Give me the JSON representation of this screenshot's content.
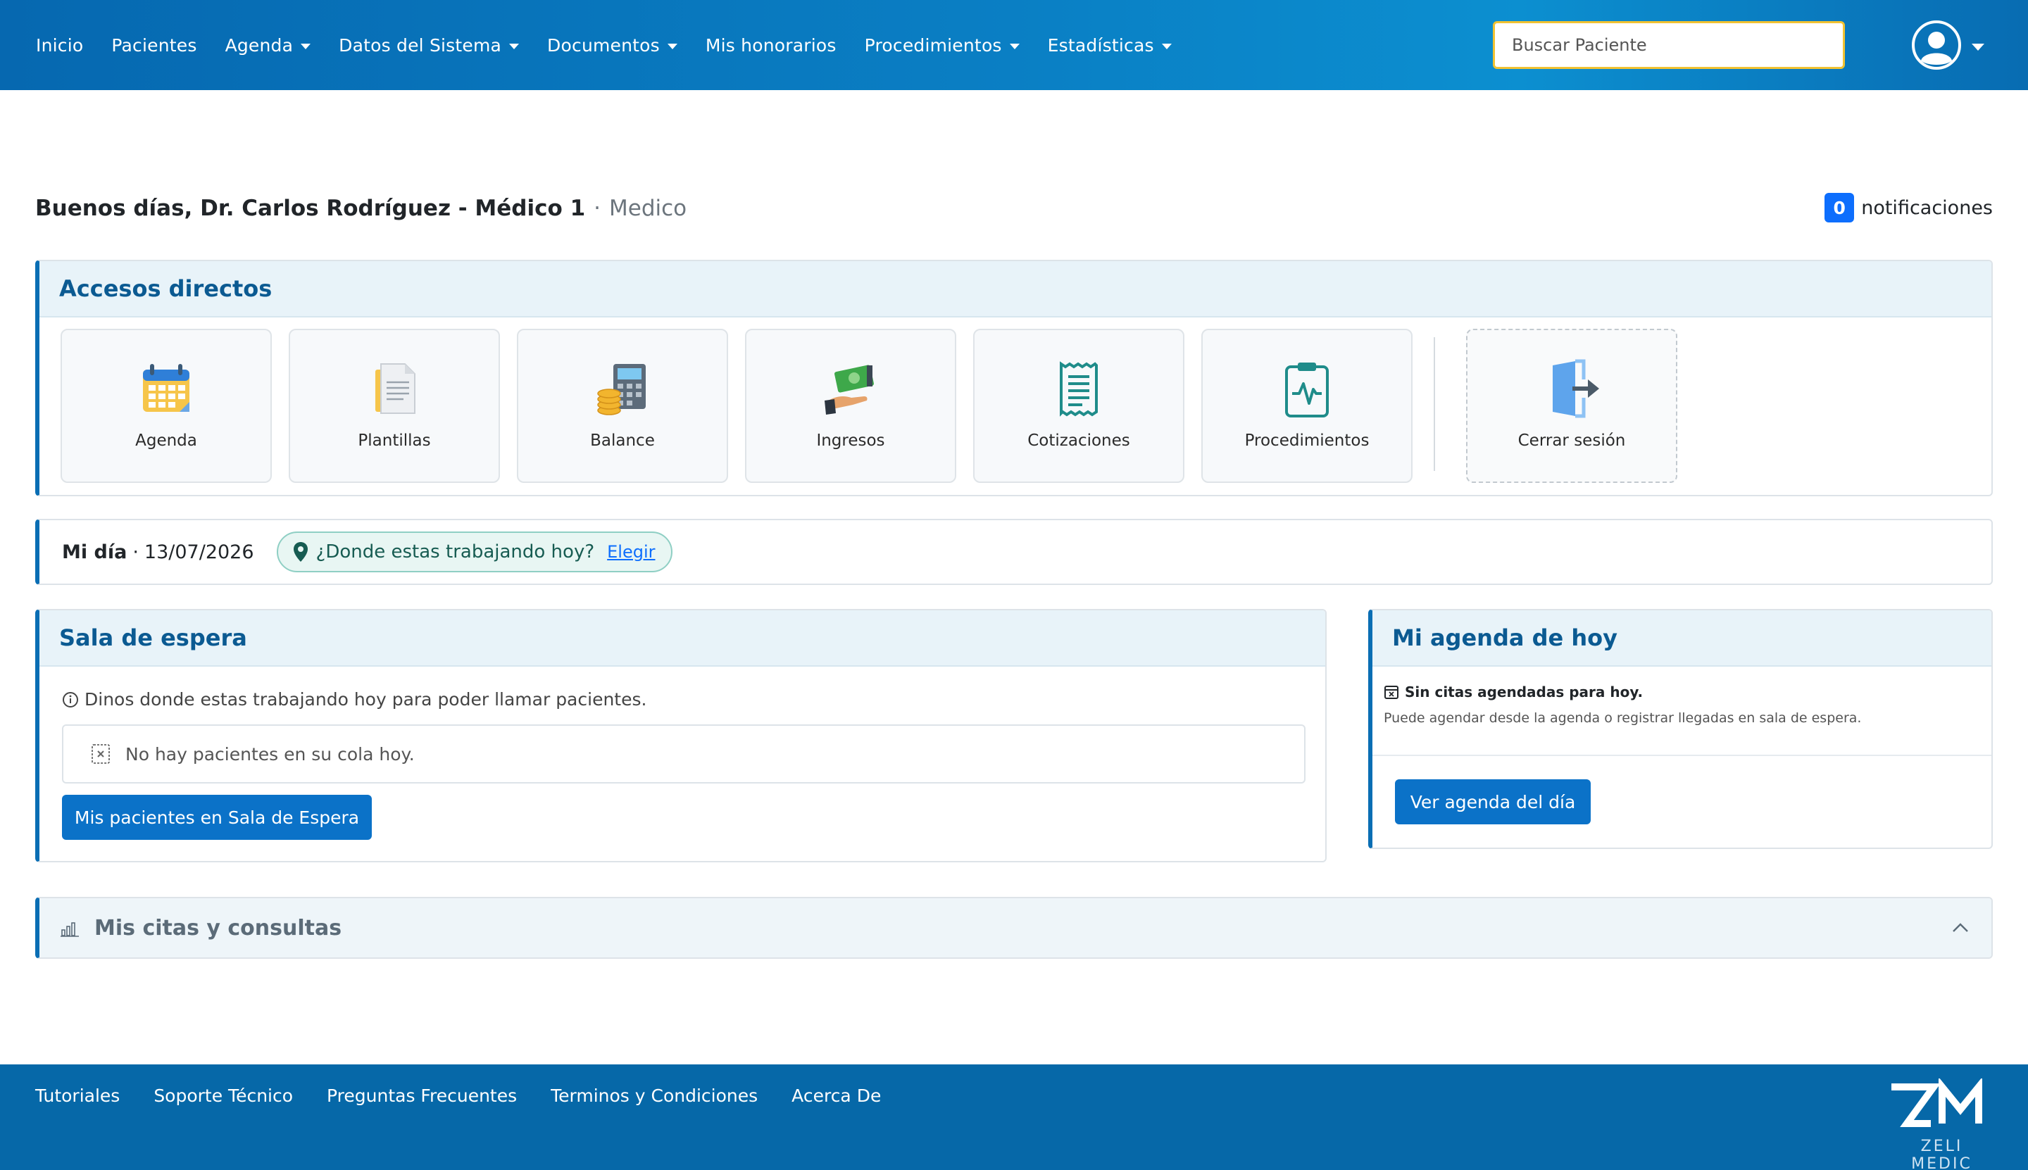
{
  "nav": {
    "items": [
      {
        "label": "Inicio",
        "dropdown": false
      },
      {
        "label": "Pacientes",
        "dropdown": false
      },
      {
        "label": "Agenda",
        "dropdown": true
      },
      {
        "label": "Datos del Sistema",
        "dropdown": true
      },
      {
        "label": "Documentos",
        "dropdown": true
      },
      {
        "label": "Mis honorarios",
        "dropdown": false
      },
      {
        "label": "Procedimientos",
        "dropdown": true
      },
      {
        "label": "Estadísticas",
        "dropdown": true
      }
    ],
    "search_placeholder": "Buscar Paciente",
    "colors": {
      "bar": "#0a7fc4",
      "search_border": "#f1c232"
    }
  },
  "greeting": {
    "text": "Buenos días, Dr. Carlos Rodríguez - Médico 1",
    "separator": "·",
    "role": "Medico"
  },
  "notifications": {
    "count": "0",
    "label": "notificaciones"
  },
  "accesos": {
    "title": "Accesos directos",
    "tiles": [
      {
        "label": "Agenda",
        "icon": "calendar-icon"
      },
      {
        "label": "Plantillas",
        "icon": "document-icon"
      },
      {
        "label": "Balance",
        "icon": "calculator-coins-icon"
      },
      {
        "label": "Ingresos",
        "icon": "money-hand-icon"
      },
      {
        "label": "Cotizaciones",
        "icon": "receipt-icon"
      },
      {
        "label": "Procedimientos",
        "icon": "clipboard-pulse-icon"
      }
    ],
    "logout": {
      "label": "Cerrar sesión",
      "icon": "logout-door-icon"
    }
  },
  "midia": {
    "label": "Mi día",
    "separator": "·",
    "date": "13/07/2026",
    "location_question": "¿Donde estas trabajando hoy?",
    "location_link": "Elegir"
  },
  "sala": {
    "title": "Sala de espera",
    "info": "Dinos donde estas trabajando hoy para poder llamar pacientes.",
    "empty": "No hay pacientes en su cola hoy.",
    "button": "Mis pacientes en Sala de Espera"
  },
  "agenda_hoy": {
    "title": "Mi agenda de hoy",
    "no_citas": "Sin citas agendadas para hoy.",
    "hint": "Puede agendar desde la agenda o registrar llegadas en sala de espera.",
    "button": "Ver agenda del día"
  },
  "citas": {
    "title": "Mis citas y consultas"
  },
  "footer": {
    "links": [
      "Tutoriales",
      "Soporte Técnico",
      "Preguntas Frecuentes",
      "Terminos y Condiciones",
      "Acerca De"
    ],
    "logo_text": "ZELI MEDIC",
    "color": "#0668a8"
  }
}
